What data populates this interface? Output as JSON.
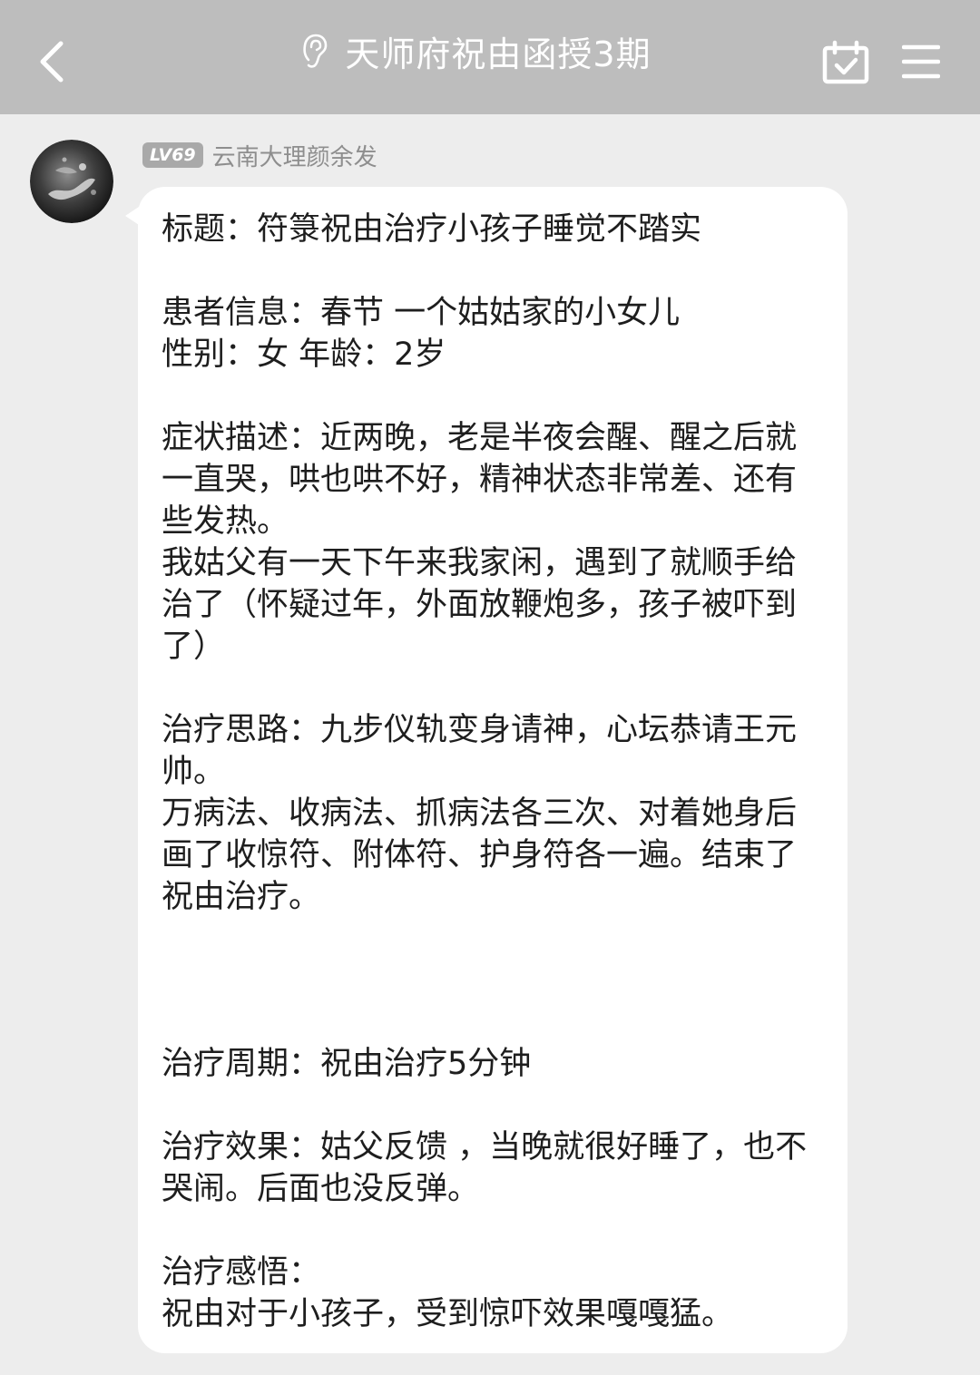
{
  "header": {
    "title": "天师府祝由函授3期",
    "back_icon": "chevron-left-icon",
    "title_icon": "ear-icon",
    "calendar_icon": "calendar-check-icon",
    "menu_icon": "menu-icon"
  },
  "message": {
    "sender_level": "LV69",
    "sender_name": "云南大理颜余发",
    "avatar_icon": "avatar-image",
    "text": "标题：符箓祝由治疗小孩子睡觉不踏实\n\n患者信息：春节 一个姑姑家的小女儿\n性别：女 年龄：2岁\n\n症状描述：近两晚，老是半夜会醒、醒之后就一直哭，哄也哄不好，精神状态非常差、还有些发热。\n我姑父有一天下午来我家闲，遇到了就顺手给治了（怀疑过年，外面放鞭炮多，孩子被吓到了）\n\n治疗思路：九步仪轨变身请神，心坛恭请王元帅。\n万病法、收病法、抓病法各三次、对着她身后画了收惊符、附体符、护身符各一遍。结束了祝由治疗。\n\n\n\n治疗周期：祝由治疗5分钟\n\n治疗效果：姑父反馈 ，当晚就很好睡了，也不哭闹。后面也没反弹。\n\n治疗感悟：\n祝由对于小孩子，受到惊吓效果嘎嘎猛。"
  },
  "colors": {
    "header_bg": "#bdbdbd",
    "page_bg": "#ededed",
    "bubble_bg": "#ffffff",
    "level_badge_bg": "#a9a9a9",
    "sender_name": "#8e8e8e"
  }
}
